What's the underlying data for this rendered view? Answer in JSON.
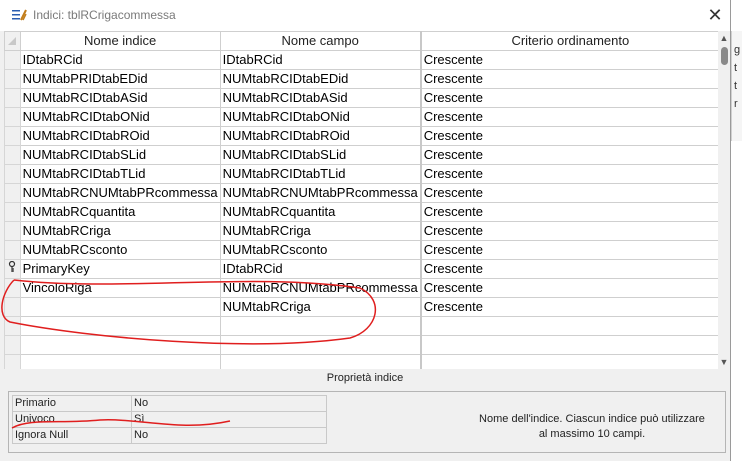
{
  "window": {
    "title": "Indici: tblRCrigacommessa",
    "close_glyph": "✕",
    "icon": "index-icon"
  },
  "grid": {
    "columns": [
      "Nome indice",
      "Nome campo",
      "Criterio ordinamento"
    ],
    "rows": [
      {
        "marker": "",
        "index_name": "IDtabRCid",
        "field_name": "IDtabRCid",
        "sort": "Crescente"
      },
      {
        "marker": "",
        "index_name": "NUMtabPRIDtabEDid",
        "field_name": "NUMtabRCIDtabEDid",
        "sort": "Crescente"
      },
      {
        "marker": "",
        "index_name": "NUMtabRCIDtabASid",
        "field_name": "NUMtabRCIDtabASid",
        "sort": "Crescente"
      },
      {
        "marker": "",
        "index_name": "NUMtabRCIDtabONid",
        "field_name": "NUMtabRCIDtabONid",
        "sort": "Crescente"
      },
      {
        "marker": "",
        "index_name": "NUMtabRCIDtabROid",
        "field_name": "NUMtabRCIDtabROid",
        "sort": "Crescente"
      },
      {
        "marker": "",
        "index_name": "NUMtabRCIDtabSLid",
        "field_name": "NUMtabRCIDtabSLid",
        "sort": "Crescente"
      },
      {
        "marker": "",
        "index_name": "NUMtabRCIDtabTLid",
        "field_name": "NUMtabRCIDtabTLid",
        "sort": "Crescente"
      },
      {
        "marker": "",
        "index_name": "NUMtabRCNUMtabPRcommessa",
        "field_name": "NUMtabRCNUMtabPRcommessa",
        "sort": "Crescente"
      },
      {
        "marker": "",
        "index_name": "NUMtabRCquantita",
        "field_name": "NUMtabRCquantita",
        "sort": "Crescente"
      },
      {
        "marker": "",
        "index_name": "NUMtabRCriga",
        "field_name": "NUMtabRCriga",
        "sort": "Crescente"
      },
      {
        "marker": "",
        "index_name": "NUMtabRCsconto",
        "field_name": "NUMtabRCsconto",
        "sort": "Crescente"
      },
      {
        "marker": "key",
        "index_name": "PrimaryKey",
        "field_name": "IDtabRCid",
        "sort": "Crescente"
      },
      {
        "marker": "",
        "index_name": "VincoloRiga",
        "field_name": "NUMtabRCNUMtabPRcommessa",
        "sort": "Crescente"
      },
      {
        "marker": "",
        "index_name": "",
        "field_name": "NUMtabRCriga",
        "sort": "Crescente"
      },
      {
        "marker": "",
        "index_name": "",
        "field_name": "",
        "sort": ""
      },
      {
        "marker": "",
        "index_name": "",
        "field_name": "",
        "sort": ""
      },
      {
        "marker": "",
        "index_name": "",
        "field_name": "",
        "sort": ""
      }
    ]
  },
  "properties": {
    "title": "Proprietà indice",
    "items": [
      {
        "name": "Primario",
        "value": "No"
      },
      {
        "name": "Univoco",
        "value": "Sì"
      },
      {
        "name": "Ignora Null",
        "value": "No"
      }
    ],
    "description_line1": "Nome dell'indice. Ciascun indice può utilizzare",
    "description_line2": "al massimo 10 campi."
  },
  "background_chars": [
    "g",
    "t",
    "t",
    "r"
  ],
  "colors": {
    "annotation": "#e01e1e",
    "window_bg": "#f0f0f0"
  }
}
